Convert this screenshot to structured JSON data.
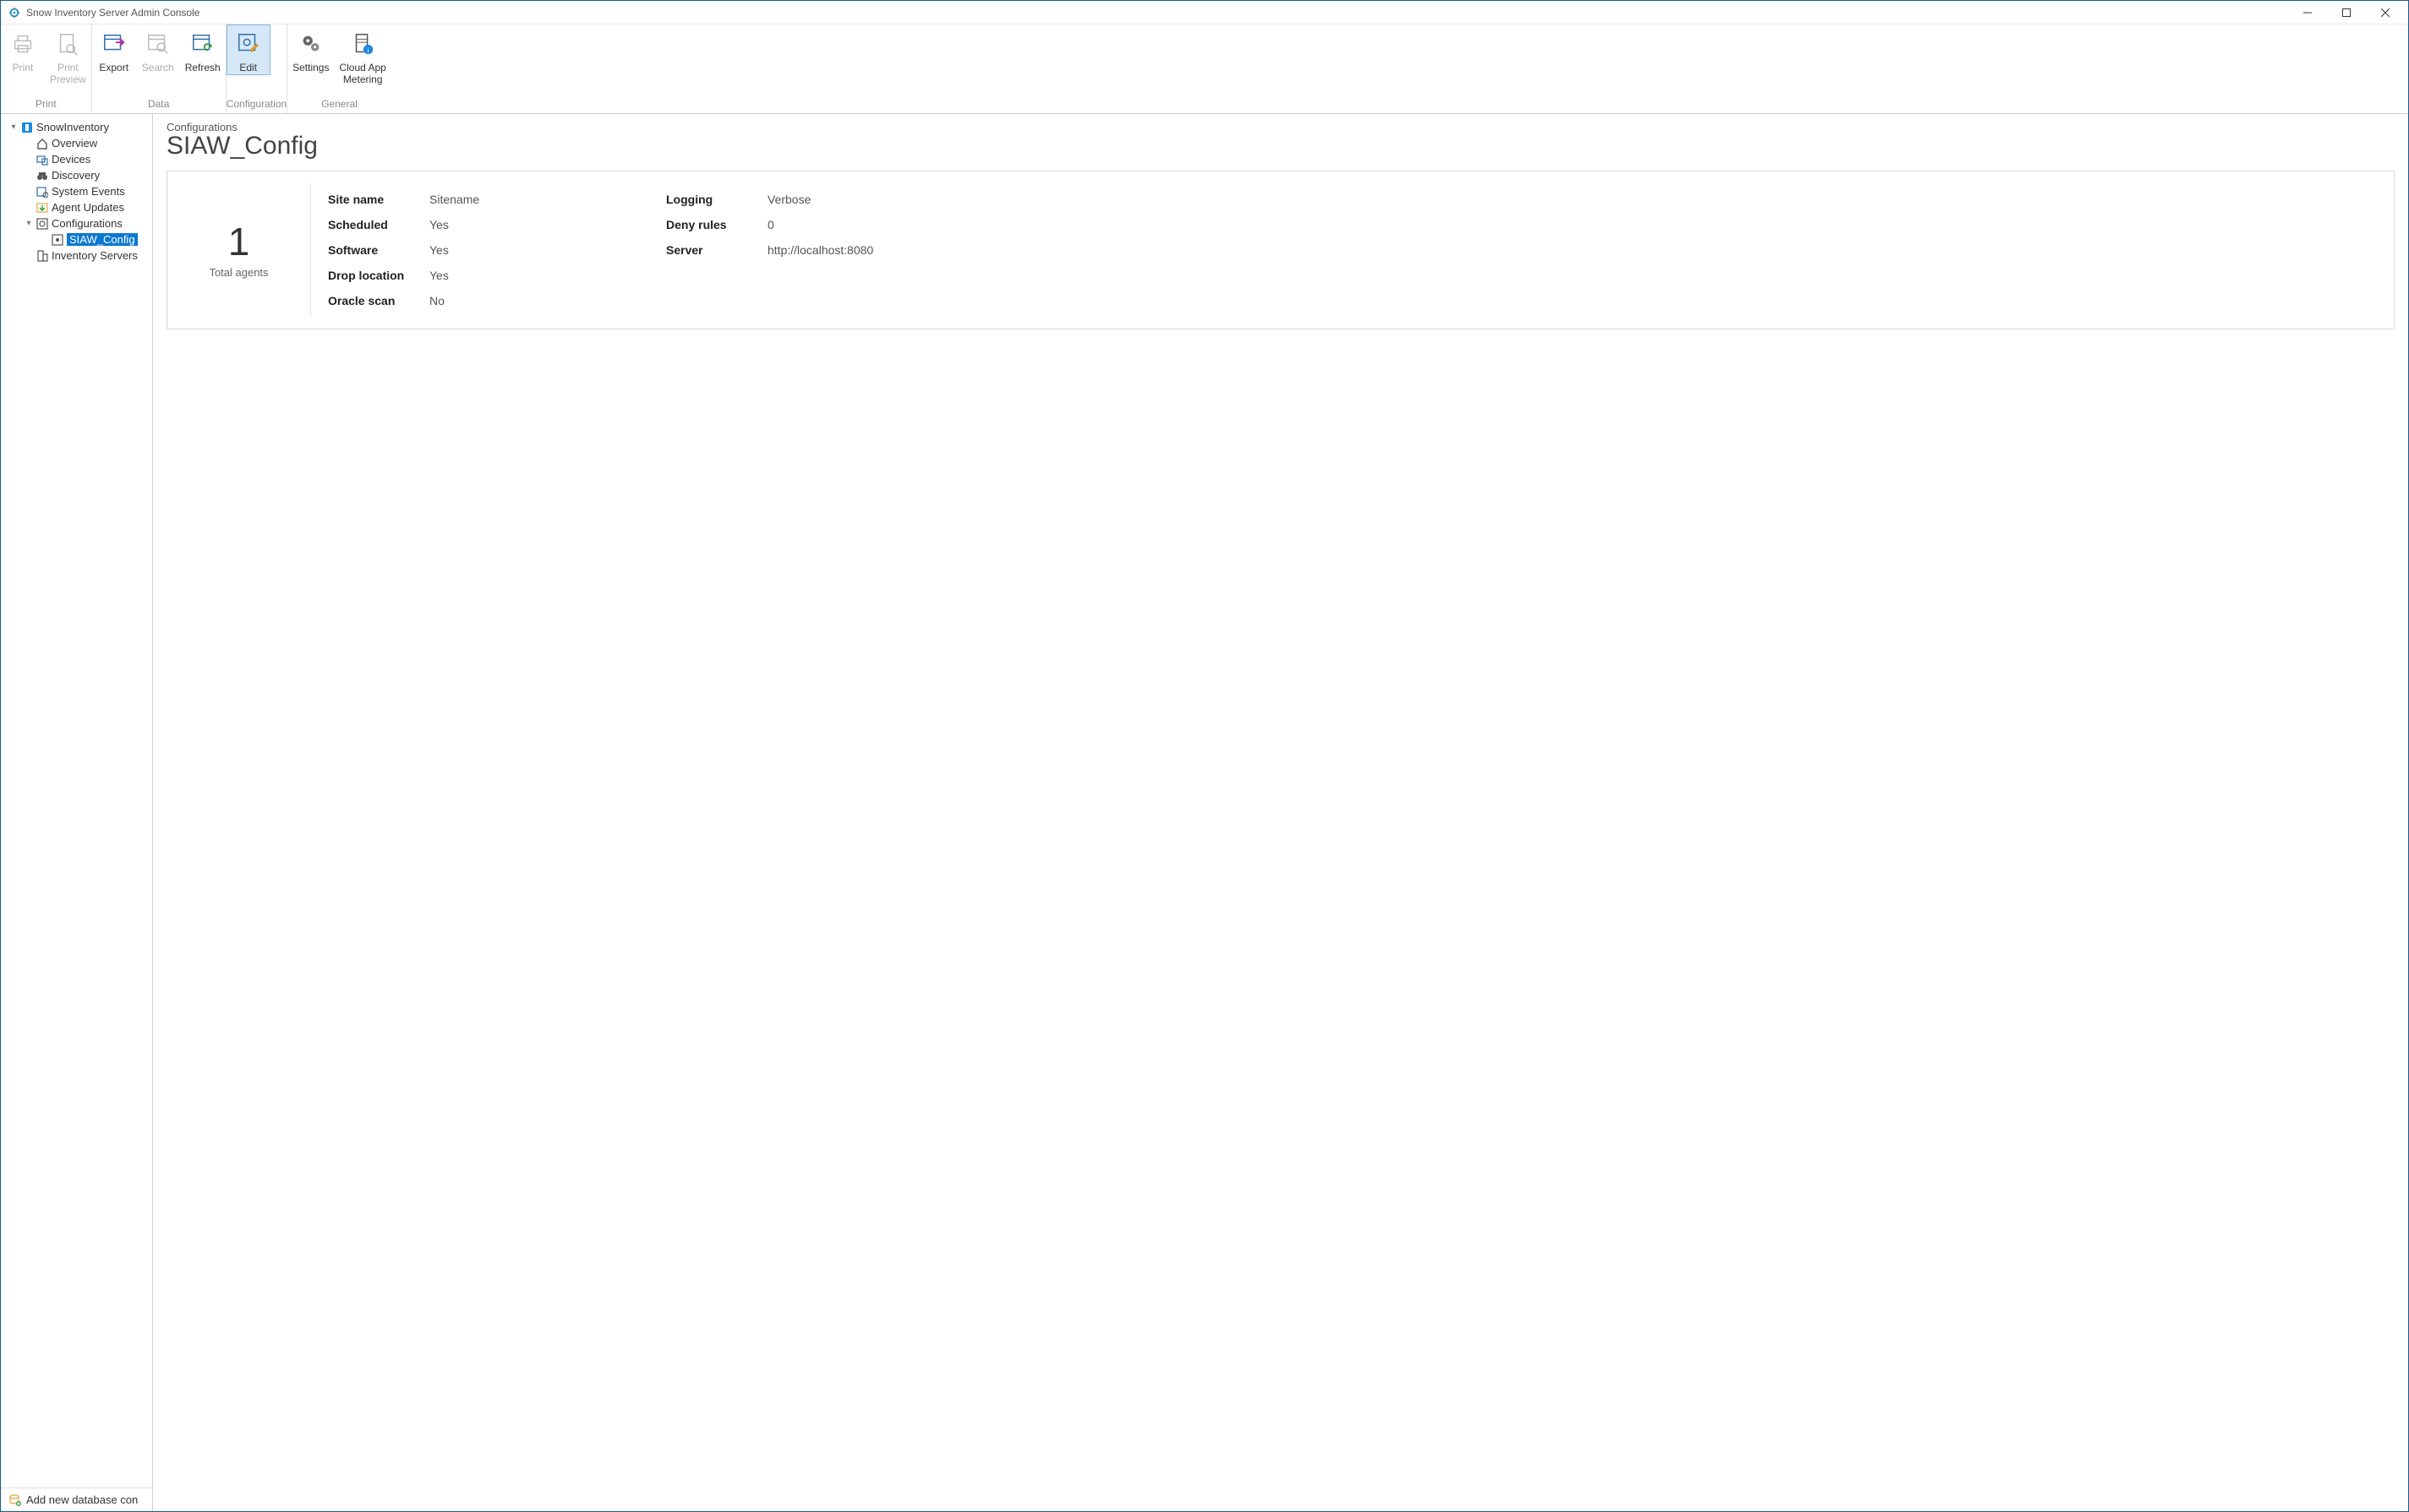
{
  "window": {
    "title": "Snow Inventory Server Admin Console"
  },
  "ribbon": {
    "groups": [
      {
        "title": "Print",
        "buttons": [
          {
            "id": "print",
            "label": "Print",
            "disabled": true
          },
          {
            "id": "print-preview",
            "label": "Print\nPreview",
            "disabled": true
          }
        ]
      },
      {
        "title": "Data",
        "buttons": [
          {
            "id": "export",
            "label": "Export",
            "disabled": false
          },
          {
            "id": "search",
            "label": "Search",
            "disabled": true
          },
          {
            "id": "refresh",
            "label": "Refresh",
            "disabled": false
          }
        ]
      },
      {
        "title": "Configuration",
        "buttons": [
          {
            "id": "edit",
            "label": "Edit",
            "disabled": false,
            "selected": true
          }
        ]
      },
      {
        "title": "General",
        "buttons": [
          {
            "id": "settings",
            "label": "Settings",
            "disabled": false
          },
          {
            "id": "cloud-app-metering",
            "label": "Cloud App\nMetering",
            "disabled": false
          }
        ]
      }
    ]
  },
  "tree": {
    "root_label": "SnowInventory",
    "items": [
      {
        "id": "overview",
        "label": "Overview"
      },
      {
        "id": "devices",
        "label": "Devices"
      },
      {
        "id": "discovery",
        "label": "Discovery"
      },
      {
        "id": "system-events",
        "label": "System Events"
      },
      {
        "id": "agent-updates",
        "label": "Agent Updates"
      },
      {
        "id": "configurations",
        "label": "Configurations",
        "expanded": true,
        "children": [
          {
            "id": "siaw-config",
            "label": "SIAW_Config",
            "selected": true
          }
        ]
      },
      {
        "id": "inventory-servers",
        "label": "Inventory Servers"
      }
    ],
    "footer_label": "Add new database con"
  },
  "main": {
    "breadcrumb": "Configurations",
    "title": "SIAW_Config",
    "agents": {
      "count": "1",
      "label": "Total agents"
    },
    "details_left": [
      {
        "k": "Site name",
        "v": "Sitename"
      },
      {
        "k": "Scheduled",
        "v": "Yes"
      },
      {
        "k": "Software",
        "v": "Yes"
      },
      {
        "k": "Drop location",
        "v": "Yes"
      },
      {
        "k": "Oracle scan",
        "v": "No"
      }
    ],
    "details_right": [
      {
        "k": "Logging",
        "v": "Verbose"
      },
      {
        "k": "Deny rules",
        "v": "0"
      },
      {
        "k": "Server",
        "v": "http://localhost:8080"
      }
    ]
  }
}
